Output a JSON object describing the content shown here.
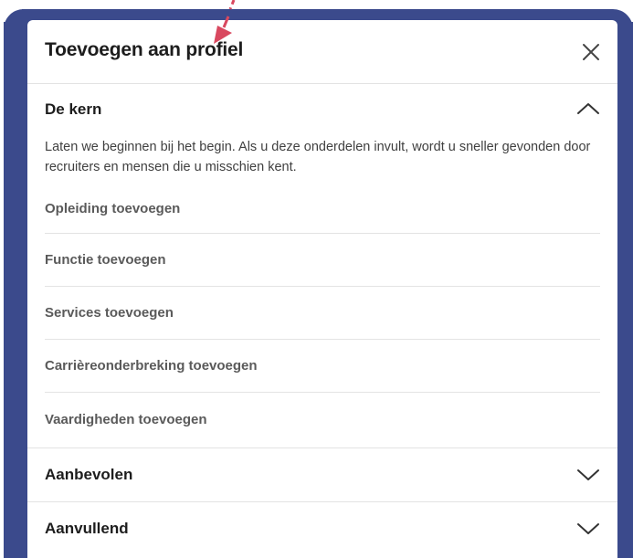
{
  "modal": {
    "title": "Toevoegen aan profiel",
    "close_icon": "close-icon"
  },
  "sections": {
    "core": {
      "label": "De kern",
      "expanded": true,
      "description": "Laten we beginnen bij het begin. Als u deze onderdelen invult, wordt u sneller gevonden door recruiters en mensen die u misschien kent.",
      "items": [
        "Opleiding toevoegen",
        "Functie toevoegen",
        "Services toevoegen",
        "Carrièreonderbreking toevoegen",
        "Vaardigheden toevoegen"
      ]
    },
    "recommended": {
      "label": "Aanbevolen",
      "expanded": false
    },
    "additional": {
      "label": "Aanvullend",
      "expanded": false
    }
  },
  "colors": {
    "frame": "#3b4a8c",
    "annotation_arrow": "#d9485f",
    "text_primary": "#1d1d1d",
    "text_secondary": "#5a5a5a"
  }
}
